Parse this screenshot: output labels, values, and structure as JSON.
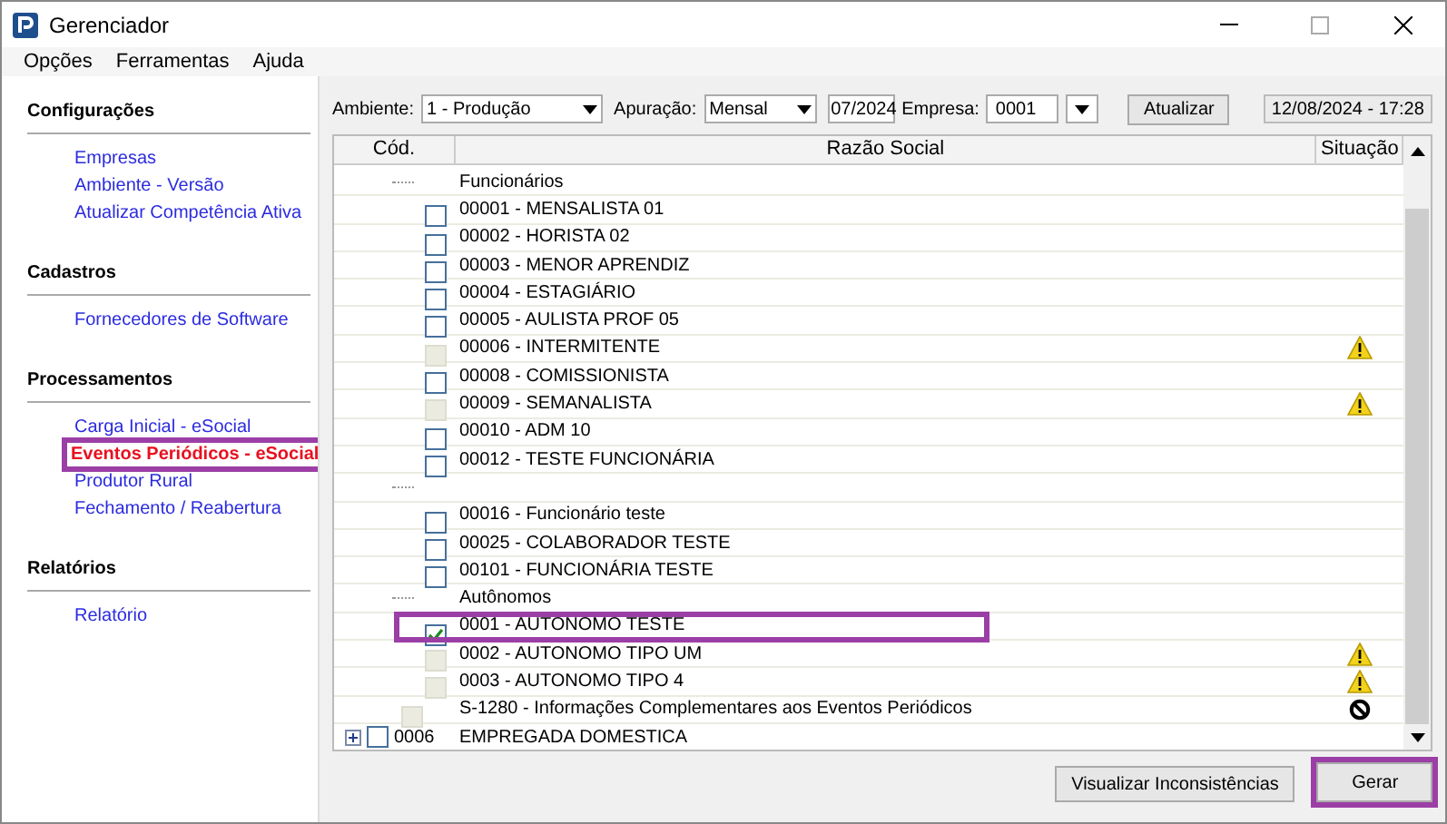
{
  "window": {
    "title": "Gerenciador"
  },
  "menu": [
    "Opções",
    "Ferramentas",
    "Ajuda"
  ],
  "sidebar": [
    {
      "title": "Configurações",
      "items": [
        {
          "label": "Empresas",
          "selected": false,
          "highlighted": false
        },
        {
          "label": "Ambiente - Versão",
          "selected": false,
          "highlighted": false
        },
        {
          "label": "Atualizar Competência Ativa",
          "selected": false,
          "highlighted": false
        }
      ]
    },
    {
      "title": "Cadastros",
      "items": [
        {
          "label": "Fornecedores de Software",
          "selected": false,
          "highlighted": false
        }
      ]
    },
    {
      "title": "Processamentos",
      "items": [
        {
          "label": "Carga Inicial - eSocial",
          "selected": false,
          "highlighted": false
        },
        {
          "label": "Eventos Periódicos - eSocial",
          "selected": true,
          "highlighted": true
        },
        {
          "label": "Produtor Rural",
          "selected": false,
          "highlighted": false
        },
        {
          "label": "Fechamento / Reabertura",
          "selected": false,
          "highlighted": false
        }
      ]
    },
    {
      "title": "Relatórios",
      "items": [
        {
          "label": "Relatório",
          "selected": false,
          "highlighted": false
        }
      ]
    }
  ],
  "toolbar": {
    "ambiente_label": "Ambiente:",
    "ambiente": "1 - Produção",
    "apuracao_label": "Apuração:",
    "apuracao": "Mensal",
    "periodo": "07/2024",
    "empresa_label": "Empresa:",
    "empresa": "0001",
    "atualizar": "Atualizar",
    "datetime": "12/08/2024 - 17:28"
  },
  "table": {
    "columns": [
      "Cód.",
      "Razão Social",
      "Situação"
    ],
    "tree": [
      {
        "kind": "group",
        "label": "Funcionários",
        "children": [
          {
            "kind": "item",
            "label": "00001 - MENSALISTA 01",
            "checked": false,
            "disabled": false,
            "highlighted": false
          },
          {
            "kind": "item",
            "label": "00002 - HORISTA 02",
            "checked": false,
            "disabled": false,
            "highlighted": false
          },
          {
            "kind": "item",
            "label": "00003 - MENOR APRENDIZ",
            "checked": false,
            "disabled": false,
            "highlighted": false
          },
          {
            "kind": "item",
            "label": "00004 - ESTAGIÁRIO",
            "checked": false,
            "disabled": false,
            "highlighted": false
          },
          {
            "kind": "item",
            "label": "00005 - AULISTA PROF 05",
            "checked": false,
            "disabled": false,
            "highlighted": false
          },
          {
            "kind": "item",
            "label": "00006 - INTERMITENTE",
            "checked": false,
            "disabled": true,
            "highlighted": false,
            "warning": true
          },
          {
            "kind": "item",
            "label": "00008 - COMISSIONISTA",
            "checked": false,
            "disabled": false,
            "highlighted": false
          },
          {
            "kind": "item",
            "label": "00009 - SEMANALISTA",
            "checked": false,
            "disabled": true,
            "highlighted": false,
            "warning": true
          },
          {
            "kind": "item",
            "label": "00010 - ADM 10",
            "checked": false,
            "disabled": false,
            "highlighted": false
          },
          {
            "kind": "item",
            "label": "00012 - TESTE FUNCIONÁRIA",
            "checked": false,
            "disabled": false,
            "highlighted": false
          }
        ]
      },
      {
        "kind": "group",
        "children": [
          {
            "kind": "item",
            "label": "00016 - Funcionário teste",
            "checked": false,
            "disabled": false,
            "highlighted": false
          },
          {
            "kind": "item",
            "label": "00025 - COLABORADOR TESTE",
            "checked": false,
            "disabled": false,
            "highlighted": false
          },
          {
            "kind": "item",
            "label": "00101 - FUNCIONÁRIA TESTE",
            "checked": false,
            "disabled": false,
            "highlighted": false
          }
        ]
      },
      {
        "kind": "group",
        "label": "Autônomos",
        "children": [
          {
            "kind": "item",
            "label": "0001 - AUTONOMO TESTE",
            "checked": true,
            "disabled": false,
            "highlighted": true
          },
          {
            "kind": "item",
            "label": "0002 - AUTONOMO TIPO UM",
            "checked": false,
            "disabled": true,
            "highlighted": false,
            "warning": true
          },
          {
            "kind": "item",
            "label": "0003 - AUTONOMO TIPO 4",
            "checked": false,
            "disabled": true,
            "highlighted": false,
            "warning": true
          }
        ]
      },
      {
        "kind": "event",
        "label": "S-1280 - Informações Complementares aos Eventos Periódicos",
        "checked": false,
        "disabled": true,
        "blocked": true
      },
      {
        "kind": "company",
        "code": "0006",
        "label": "EMPREGADA DOMESTICA",
        "checked": false,
        "expanded": false
      }
    ]
  },
  "buttons": [
    {
      "label": "Visualizar Inconsistências",
      "highlighted": false
    },
    {
      "label": "Gerar",
      "highlighted": true
    }
  ]
}
